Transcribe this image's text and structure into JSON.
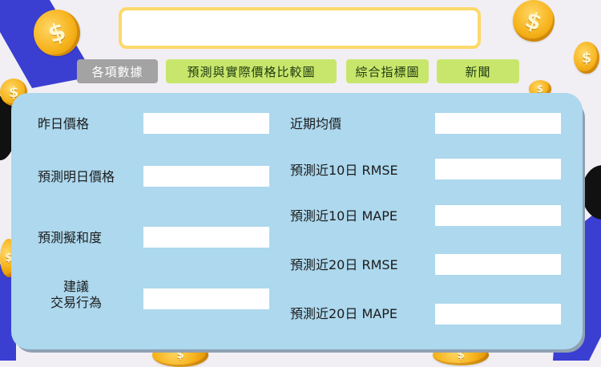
{
  "header": {
    "title_value": ""
  },
  "tabs": [
    {
      "label": "各項數據",
      "active": true
    },
    {
      "label": "預測與實際價格比較圖",
      "active": false
    },
    {
      "label": "綜合指標圖",
      "active": false
    },
    {
      "label": "新聞",
      "active": false
    }
  ],
  "left_fields": {
    "yesterday_price": {
      "label": "昨日價格",
      "value": ""
    },
    "predicted_tomorrow_price": {
      "label": "預測明日價格",
      "value": ""
    },
    "prediction_fit": {
      "label": "預測擬和度",
      "value": ""
    },
    "suggested_action": {
      "label_line1": "建議",
      "label_line2": "交易行為",
      "value": ""
    }
  },
  "right_fields": {
    "recent_avg_price": {
      "label": "近期均價",
      "value": ""
    },
    "rmse_10": {
      "label": "預測近10日 RMSE",
      "value": ""
    },
    "mape_10": {
      "label": "預測近10日 MAPE",
      "value": ""
    },
    "rmse_20": {
      "label": "預測近20日 RMSE",
      "value": ""
    },
    "mape_20": {
      "label": "預測近20日 MAPE",
      "value": ""
    }
  },
  "colors": {
    "accent_yellow": "#fcd96a",
    "tab_green": "#c8e66b",
    "tab_gray": "#a3a3a3",
    "panel_blue": "#add8ee",
    "deco_blue": "#3a3fd1"
  },
  "decor": {
    "coin_symbol": "$",
    "icon_names": [
      "coin-icon"
    ]
  }
}
